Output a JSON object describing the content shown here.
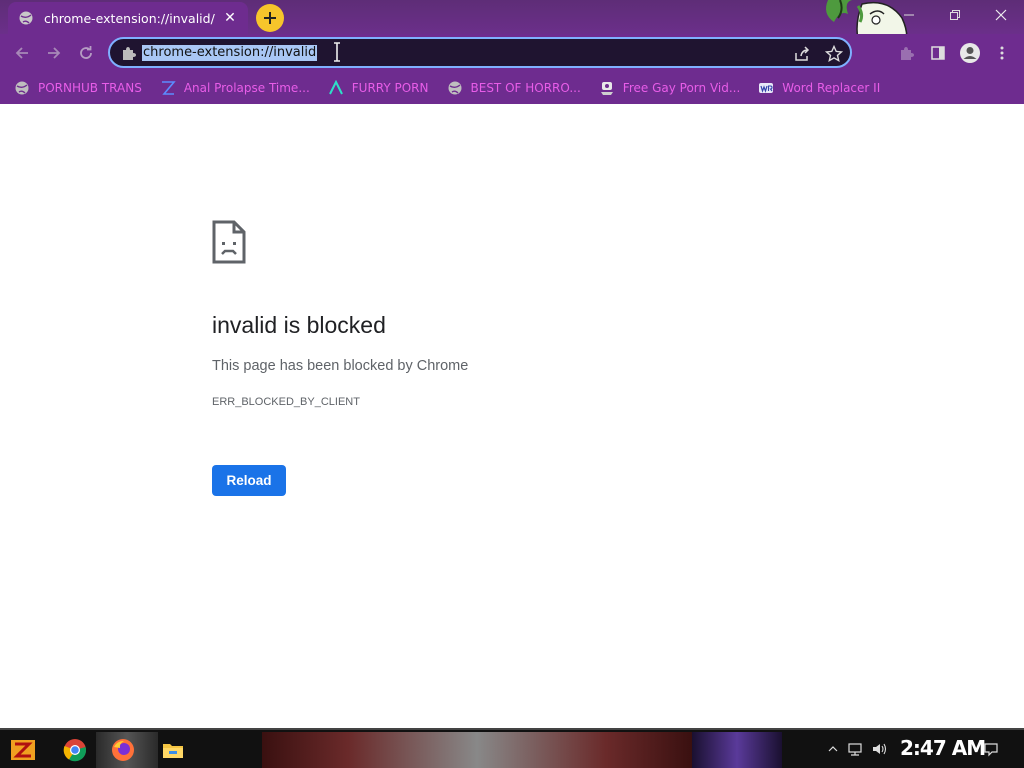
{
  "browser": {
    "tab": {
      "title": "chrome-extension://invalid/",
      "close_glyph": "✕",
      "favicon": "globe-icon"
    },
    "new_tab_glyph": "+",
    "window_controls": {
      "minimize": "—",
      "maximize": "❐",
      "close": "✕"
    },
    "omnibox": {
      "url": "chrome-extension://invalid",
      "url_selected": true
    }
  },
  "bookmarks": [
    {
      "label": "PORNHUB TRANS",
      "icon": "globe-icon"
    },
    {
      "label": "Anal Prolapse Time...",
      "icon": "bracket-icon"
    },
    {
      "label": "FURRY PORN",
      "icon": "lambda-icon"
    },
    {
      "label": "BEST OF HORRO...",
      "icon": "globe-icon"
    },
    {
      "label": "Free Gay Porn Vid...",
      "icon": "stamp-icon"
    },
    {
      "label": "Word Replacer II",
      "icon": "wr-icon"
    }
  ],
  "error_page": {
    "title": "invalid is blocked",
    "description": "This page has been blocked by Chrome",
    "error_code": "ERR_BLOCKED_BY_CLIENT",
    "reload_label": "Reload"
  },
  "taskbar": {
    "clock": "2:47 AM",
    "pinned": [
      "start-icon",
      "chrome-icon",
      "firefox-icon",
      "file-explorer-icon"
    ]
  },
  "colors": {
    "chrome_frame": "#6e2c8f",
    "bookmark_text": "#e85de8",
    "selection": "#a9c7f5",
    "reload_button": "#1a73e8",
    "new_tab_button": "#f7c52b"
  }
}
